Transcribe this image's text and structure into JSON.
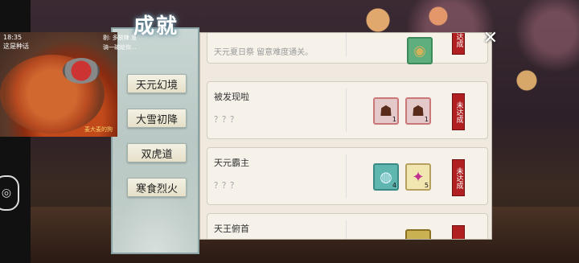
{
  "window": {
    "title": "成就"
  },
  "categories": [
    {
      "label": "天元幻境"
    },
    {
      "label": "大雪初降"
    },
    {
      "label": "双虎道"
    },
    {
      "label": "寒食烈火"
    }
  ],
  "achievements": [
    {
      "title": "",
      "desc": "天元夏日祭 留意难度通关。",
      "rewards": [
        {
          "icon": "green-item-icon",
          "qty": ""
        }
      ],
      "status": "未达成"
    },
    {
      "title": "被发现啦",
      "desc": "？？？",
      "rewards": [
        {
          "icon": "mystery-item-icon",
          "qty": "1"
        },
        {
          "icon": "mystery-item-icon",
          "qty": "1"
        }
      ],
      "status": "未达成"
    },
    {
      "title": "天元霸主",
      "desc": "？？？",
      "rewards": [
        {
          "icon": "crystal-orb-icon",
          "qty": "4"
        },
        {
          "icon": "star-gem-icon",
          "qty": "5"
        }
      ],
      "status": "未达成"
    },
    {
      "title": "天王俯首",
      "desc": "",
      "rewards": [
        {
          "icon": "gold-item-icon",
          "qty": ""
        }
      ],
      "status": "未"
    }
  ],
  "stream_overlay": {
    "line1": "18:35",
    "line2": "这是种话",
    "chat1": "剔: 多放辣 渔",
    "chat2": "骑一碗给你...",
    "signature": "麦大麦的狗"
  },
  "colors": {
    "status_red": "#b02020",
    "panel_bg": "#efe9df",
    "sidebar_bg": "#c9d6d3"
  }
}
